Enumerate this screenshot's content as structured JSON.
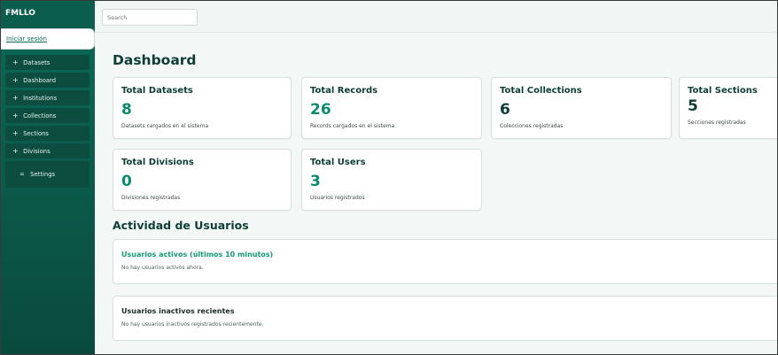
{
  "sidebar": {
    "brand": "FMLLO",
    "login": "Iniciar sesión",
    "items": [
      {
        "icon": "plus-icon",
        "label": "Datasets"
      },
      {
        "icon": "plus-icon",
        "label": "Dashboard"
      },
      {
        "icon": "plus-icon",
        "label": "Institutions"
      },
      {
        "icon": "plus-icon",
        "label": "Collections"
      },
      {
        "icon": "plus-icon",
        "label": "Sections"
      },
      {
        "icon": "plus-icon",
        "label": "Divisions"
      }
    ],
    "settings": {
      "icon": "menu-icon",
      "label": "Settings"
    }
  },
  "search": {
    "placeholder": "Search"
  },
  "page": {
    "title": "Dashboard"
  },
  "stats": [
    {
      "title": "Total Datasets",
      "value": "8",
      "desc": "Datasets cargados en el sistema"
    },
    {
      "title": "Total Records",
      "value": "26",
      "desc": "Records cargados en el sistema"
    },
    {
      "title": "Total Collections",
      "value": "6",
      "desc": "Colecciones registradas"
    },
    {
      "title": "Total Sections",
      "value": "5",
      "desc": "Secciones registradas"
    },
    {
      "title": "Total Divisions",
      "value": "0",
      "desc": "Divisiones registradas"
    },
    {
      "title": "Total Users",
      "value": "3",
      "desc": "Usuarios registrados"
    }
  ],
  "activity": {
    "title": "Actividad de Usuarios",
    "active": {
      "title": "Usuarios activos (últimos 10 minutos)",
      "text": "No hay usuarios activos ahora."
    },
    "inactive": {
      "title": "Usuarios inactivos recientes",
      "text": "No hay usuarios inactivos registrados recientemente."
    }
  },
  "colors": {
    "accent": "#0b8a6e",
    "sidebar": "#0a6b57",
    "heading": "#0e3d36"
  }
}
